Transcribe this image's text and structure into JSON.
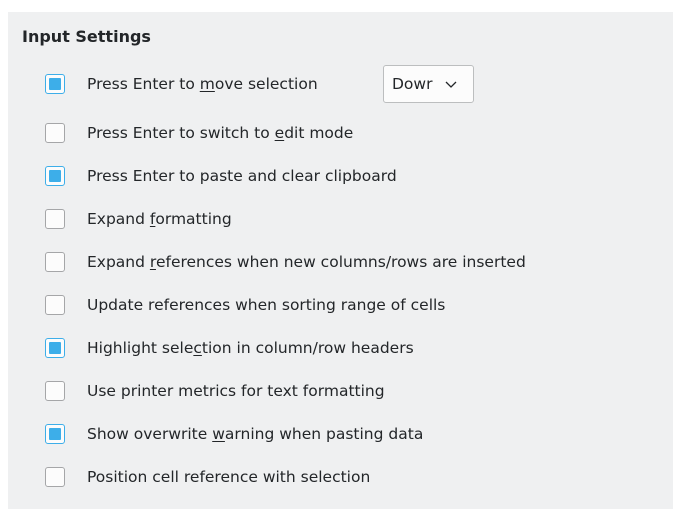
{
  "section": {
    "title": "Input Settings"
  },
  "options": [
    {
      "before": "Press Enter to ",
      "mnemonic": "m",
      "after": "ove selection",
      "checked": true
    },
    {
      "before": "Press Enter to switch to ",
      "mnemonic": "e",
      "after": "dit mode",
      "checked": false
    },
    {
      "before": "Press Enter to paste and clear clipboard",
      "mnemonic": "",
      "after": "",
      "checked": true
    },
    {
      "before": "Expand ",
      "mnemonic": "f",
      "after": "ormatting",
      "checked": false
    },
    {
      "before": "Expand ",
      "mnemonic": "r",
      "after": "eferences when new columns/rows are inserted",
      "checked": false
    },
    {
      "before": "Update references when sorting range of cells",
      "mnemonic": "",
      "after": "",
      "checked": false
    },
    {
      "before": "Highlight sele",
      "mnemonic": "c",
      "after": "tion in column/row headers",
      "checked": true
    },
    {
      "before": "Use printer metrics for text formatting",
      "mnemonic": "",
      "after": "",
      "checked": false
    },
    {
      "before": "Show overwrite ",
      "mnemonic": "w",
      "after": "arning when pasting data",
      "checked": true
    },
    {
      "before": "Position cell reference with selection",
      "mnemonic": "",
      "after": "",
      "checked": false
    }
  ],
  "move_direction": {
    "value": "Dowr",
    "icon": "chevron-down-icon"
  },
  "colors": {
    "accent": "#3daee9",
    "panel_background": "#eff0f1",
    "text": "#232629"
  }
}
